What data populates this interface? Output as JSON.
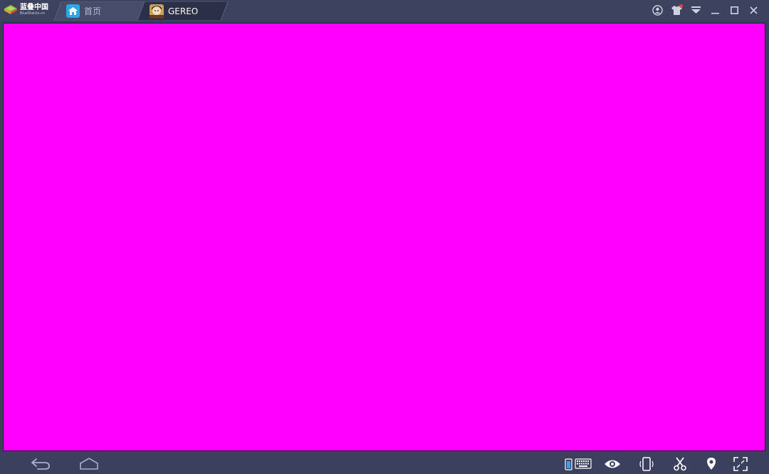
{
  "app": {
    "brand_name": "蓝叠中国",
    "brand_sub": "BlueStacks.cn",
    "accent": "#2ea7e6",
    "screen_color": "#ff00ff"
  },
  "tabs": [
    {
      "label": "首页",
      "icon": "home-icon",
      "active": false
    },
    {
      "label": "GEREO",
      "icon": "game-app-icon",
      "active": true
    }
  ],
  "title_controls": [
    {
      "name": "account-icon"
    },
    {
      "name": "theme-shirt-icon",
      "has_notification": true
    },
    {
      "name": "dropdown-menu-icon"
    },
    {
      "name": "minimize-icon"
    },
    {
      "name": "maximize-icon"
    },
    {
      "name": "close-icon"
    }
  ],
  "bottom_nav": [
    {
      "name": "back-icon"
    },
    {
      "name": "home-outline-icon"
    }
  ],
  "bottom_tools": [
    {
      "name": "keyboard-mapping-icon"
    },
    {
      "name": "eye-icon"
    },
    {
      "name": "shake-rotate-icon"
    },
    {
      "name": "scissors-icon"
    },
    {
      "name": "location-pin-icon"
    },
    {
      "name": "fullscreen-icon"
    }
  ]
}
